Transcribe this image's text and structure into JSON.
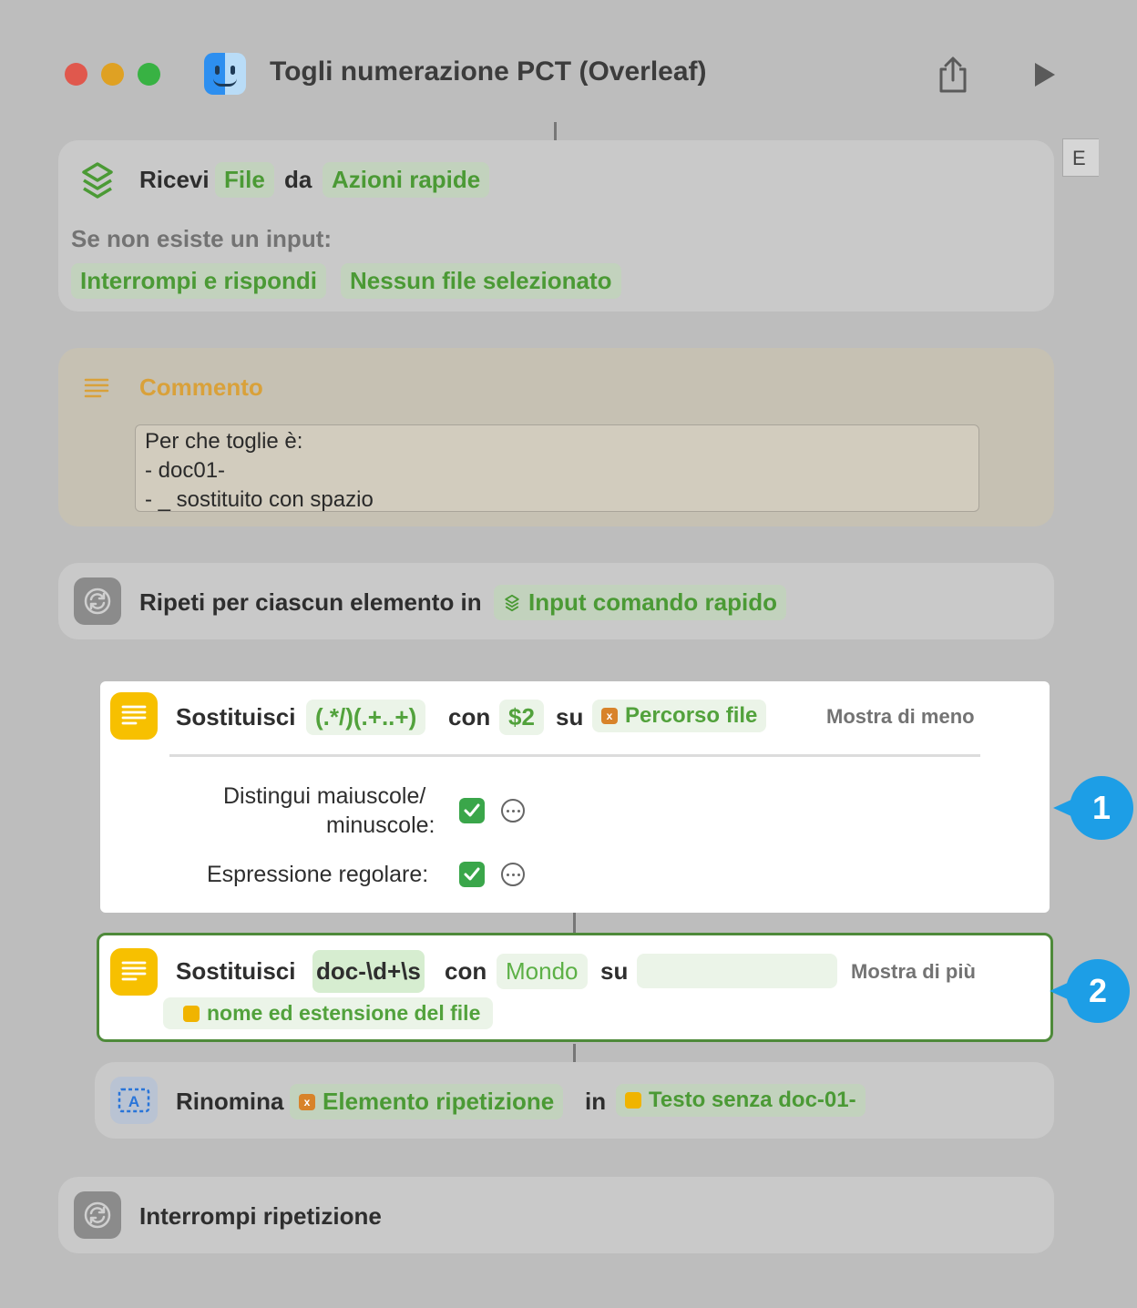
{
  "window": {
    "title": "Togli numerazione PCT (Overleaf)",
    "traffic_colors": [
      "#e0584d",
      "#dfa123",
      "#38b243"
    ]
  },
  "tooltip_fragment": "E",
  "receive": {
    "label": "Ricevi",
    "type": "File",
    "from_label": "da",
    "source": "Azioni rapide",
    "no_input_label": "Se non esiste un input:",
    "action": "Interrompi e rispondi",
    "response": "Nessun file selezionato"
  },
  "comment": {
    "title": "Commento",
    "lines": [
      "Per che toglie è:",
      "- doc01-",
      "- _ sostituito con spazio"
    ]
  },
  "repeat": {
    "label": "Ripeti per ciascun elemento in",
    "input": "Input comando rapido"
  },
  "replace1": {
    "label": "Sostituisci",
    "pattern": "(.*/)(.+..+)",
    "with_label": "con",
    "replacement": "$2",
    "on_label": "su",
    "target": "Percorso file",
    "toggle_label": "Mostra di meno",
    "option1_line1": "Distingui maiuscole/",
    "option1_line2": "minuscole:",
    "option1_checked": true,
    "option2": "Espressione regolare:",
    "option2_checked": true
  },
  "replace2": {
    "label": "Sostituisci",
    "pattern": "doc-\\d+\\s",
    "with_label": "con",
    "replacement": "Mondo",
    "on_label": "su",
    "target": "",
    "toggle_label": "Mostra di più",
    "target2": "nome ed estensione del file"
  },
  "rename": {
    "label": "Rinomina",
    "item": "Elemento ripetizione",
    "in_label": "in",
    "value": "Testo senza doc-01-"
  },
  "end_repeat": {
    "label": "Interrompi ripetizione"
  },
  "badges": [
    "1",
    "2"
  ],
  "colors": {
    "accent_green": "#4b9a35",
    "comment_orange": "#d9a13a",
    "badge_blue": "#1d9ee6",
    "selection_green": "#4e8a3a"
  }
}
